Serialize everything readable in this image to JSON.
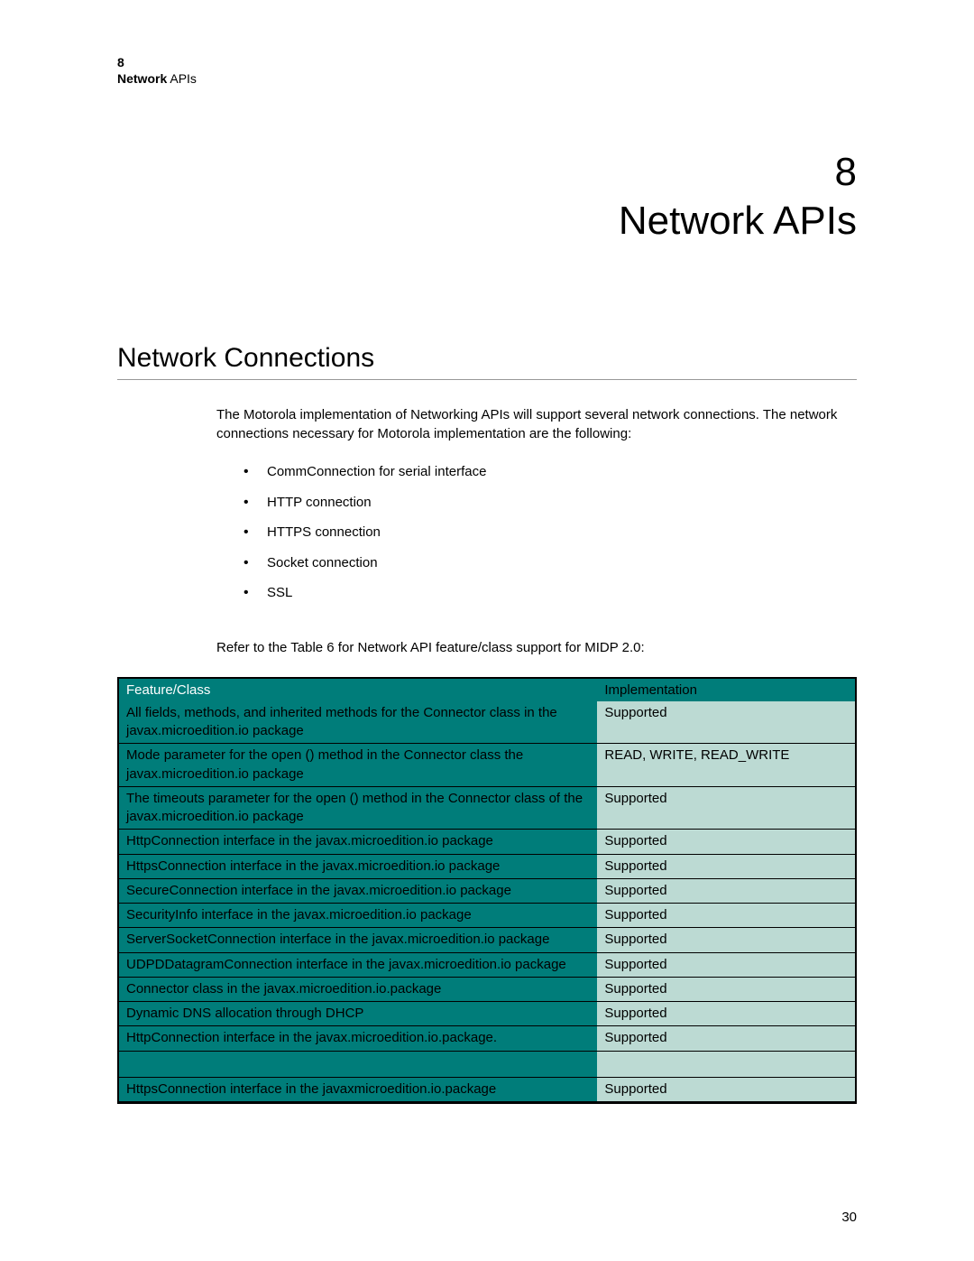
{
  "running_head": {
    "number": "8",
    "title_bold": "Network",
    "title_rest": " APIs"
  },
  "chapter": {
    "number": "8",
    "title": "Network APIs"
  },
  "section_heading": "Network Connections",
  "intro_para": "The Motorola implementation of Networking APIs will support several network connections. The network connections necessary for Motorola implementation are the following:",
  "bullets": [
    "CommConnection for serial interface",
    "HTTP connection",
    "HTTPS connection",
    "Socket connection",
    "SSL"
  ],
  "refer_para": "Refer to the Table 6 for Network API feature/class support for MIDP 2.0:",
  "table": {
    "headers": {
      "feature": "Feature/Class",
      "impl": "Implementation"
    },
    "rows": [
      {
        "feature": "All fields, methods, and inherited methods for the Connector class in the javax.microedition.io package",
        "impl": "Supported"
      },
      {
        "feature": "Mode parameter for the open () method in the Connector class the javax.microedition.io package",
        "impl": "READ, WRITE, READ_WRITE"
      },
      {
        "feature": "The timeouts parameter for the open () method in the Connector class of the javax.microedition.io package",
        "impl": "Supported"
      },
      {
        "feature": "HttpConnection interface in the javax.microedition.io package",
        "impl": "Supported"
      },
      {
        "feature": "HttpsConnection interface in the javax.microedition.io package",
        "impl": "Supported"
      },
      {
        "feature": "SecureConnection interface in the javax.microedition.io package",
        "impl": "Supported"
      },
      {
        "feature": "SecurityInfo interface in the javax.microedition.io package",
        "impl": "Supported"
      },
      {
        "feature": "ServerSocketConnection interface in the javax.microedition.io package",
        "impl": "Supported"
      },
      {
        "feature": "UDPDDatagramConnection interface in the javax.microedition.io package",
        "impl": "Supported"
      },
      {
        "feature": "Connector class in the javax.microedition.io.package",
        "impl": "Supported"
      },
      {
        "feature": "Dynamic DNS allocation through DHCP",
        "impl": "Supported"
      },
      {
        "feature": "HttpConnection interface in the javax.microedition.io.package.",
        "impl": "Supported",
        "spacer_after": true
      },
      {
        "feature": "HttpsConnection interface in the javaxmicroedition.io.package",
        "impl": "Supported"
      }
    ]
  },
  "page_number": "30"
}
